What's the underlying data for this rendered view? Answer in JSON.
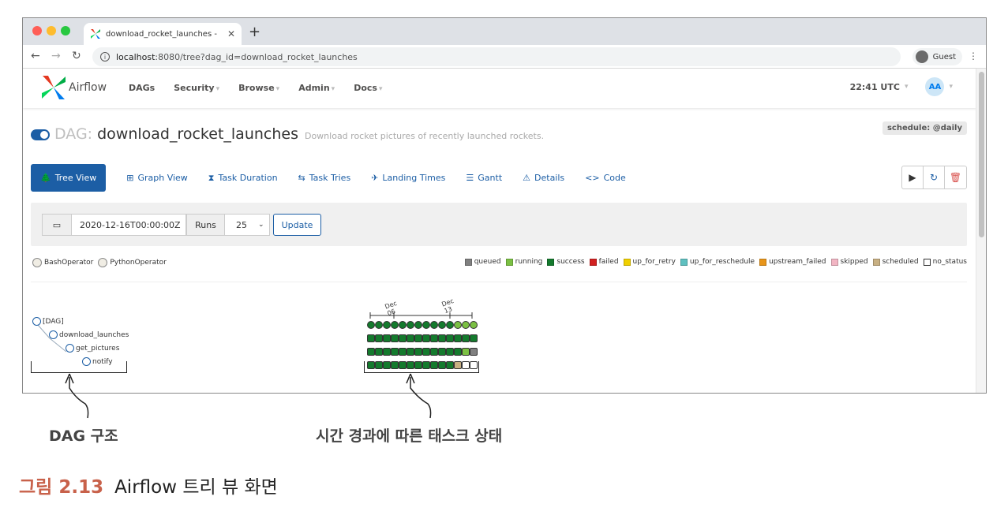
{
  "browser": {
    "tab_title": "download_rocket_launches - ",
    "url_host": "localhost",
    "url_rest": ":8080/tree?dag_id=download_rocket_launches",
    "profile_label": "Guest"
  },
  "navbar": {
    "brand": "Airflow",
    "menu": [
      {
        "label": "DAGs",
        "caret": false
      },
      {
        "label": "Security",
        "caret": true
      },
      {
        "label": "Browse",
        "caret": true
      },
      {
        "label": "Admin",
        "caret": true
      },
      {
        "label": "Docs",
        "caret": true
      }
    ],
    "time": "22:41 UTC",
    "user_initials": "AA"
  },
  "dag": {
    "prefix": "DAG:",
    "name": "download_rocket_launches",
    "description": "Download rocket pictures of recently launched rockets.",
    "schedule": "schedule: @daily"
  },
  "tabs": [
    {
      "label": "Tree View",
      "icon": "tree-icon",
      "glyph": "🌲",
      "active": true
    },
    {
      "label": "Graph View",
      "icon": "graph-icon",
      "glyph": "⊞",
      "active": false
    },
    {
      "label": "Task Duration",
      "icon": "hourglass-icon",
      "glyph": "⧗",
      "active": false
    },
    {
      "label": "Task Tries",
      "icon": "retry-icon",
      "glyph": "⇆",
      "active": false
    },
    {
      "label": "Landing Times",
      "icon": "plane-icon",
      "glyph": "✈",
      "active": false
    },
    {
      "label": "Gantt",
      "icon": "gantt-icon",
      "glyph": "☰",
      "active": false
    },
    {
      "label": "Details",
      "icon": "warning-icon",
      "glyph": "⚠",
      "active": false
    },
    {
      "label": "Code",
      "icon": "code-icon",
      "glyph": "<>",
      "active": false
    }
  ],
  "actions": [
    {
      "name": "trigger-dag-button",
      "icon": "play-icon",
      "glyph": "▶",
      "color": "#333333"
    },
    {
      "name": "refresh-button",
      "icon": "refresh-icon",
      "glyph": "↻",
      "color": "#1c5ea5"
    },
    {
      "name": "delete-dag-button",
      "icon": "trash-icon",
      "glyph": "🗑",
      "color": "#d9534f"
    }
  ],
  "form": {
    "base_date": "2020-12-16T00:00:00Z",
    "runs_label": "Runs",
    "num_runs": "25",
    "update_label": "Update"
  },
  "operators": [
    {
      "label": "BashOperator"
    },
    {
      "label": "PythonOperator"
    }
  ],
  "states": [
    {
      "label": "queued",
      "color": "#808080"
    },
    {
      "label": "running",
      "color": "#7bc043"
    },
    {
      "label": "success",
      "color": "#147a2d"
    },
    {
      "label": "failed",
      "color": "#d12020"
    },
    {
      "label": "up_for_retry",
      "color": "#f0d000"
    },
    {
      "label": "up_for_reschedule",
      "color": "#5fc0c0"
    },
    {
      "label": "upstream_failed",
      "color": "#e8951a"
    },
    {
      "label": "skipped",
      "color": "#f2b5c3"
    },
    {
      "label": "scheduled",
      "color": "#c8b083"
    },
    {
      "label": "no_status",
      "color": "#ffffff"
    }
  ],
  "tree": {
    "nodes": [
      {
        "label": "[DAG]"
      },
      {
        "label": "download_launches"
      },
      {
        "label": "get_pictures"
      },
      {
        "label": "notify"
      }
    ],
    "date_labels": [
      "Dec 06",
      "Dec 13"
    ],
    "rows": [
      [
        "success",
        "success",
        "success",
        "success",
        "success",
        "success",
        "success",
        "success",
        "success",
        "success",
        "success",
        "running",
        "running",
        "running"
      ],
      [
        "success",
        "success",
        "success",
        "success",
        "success",
        "success",
        "success",
        "success",
        "success",
        "success",
        "success",
        "success",
        "success",
        "success"
      ],
      [
        "success",
        "success",
        "success",
        "success",
        "success",
        "success",
        "success",
        "success",
        "success",
        "success",
        "success",
        "success",
        "running",
        "queued"
      ],
      [
        "success",
        "success",
        "success",
        "success",
        "success",
        "success",
        "success",
        "success",
        "success",
        "success",
        "success",
        "scheduled",
        "no_status",
        "no_status"
      ]
    ]
  },
  "annotations": {
    "left": "DAG 구조",
    "right": "시간 경과에 따른 태스크 상태"
  },
  "caption": {
    "number": "그림 2.13",
    "title": "Airflow 트리 뷰 화면"
  }
}
